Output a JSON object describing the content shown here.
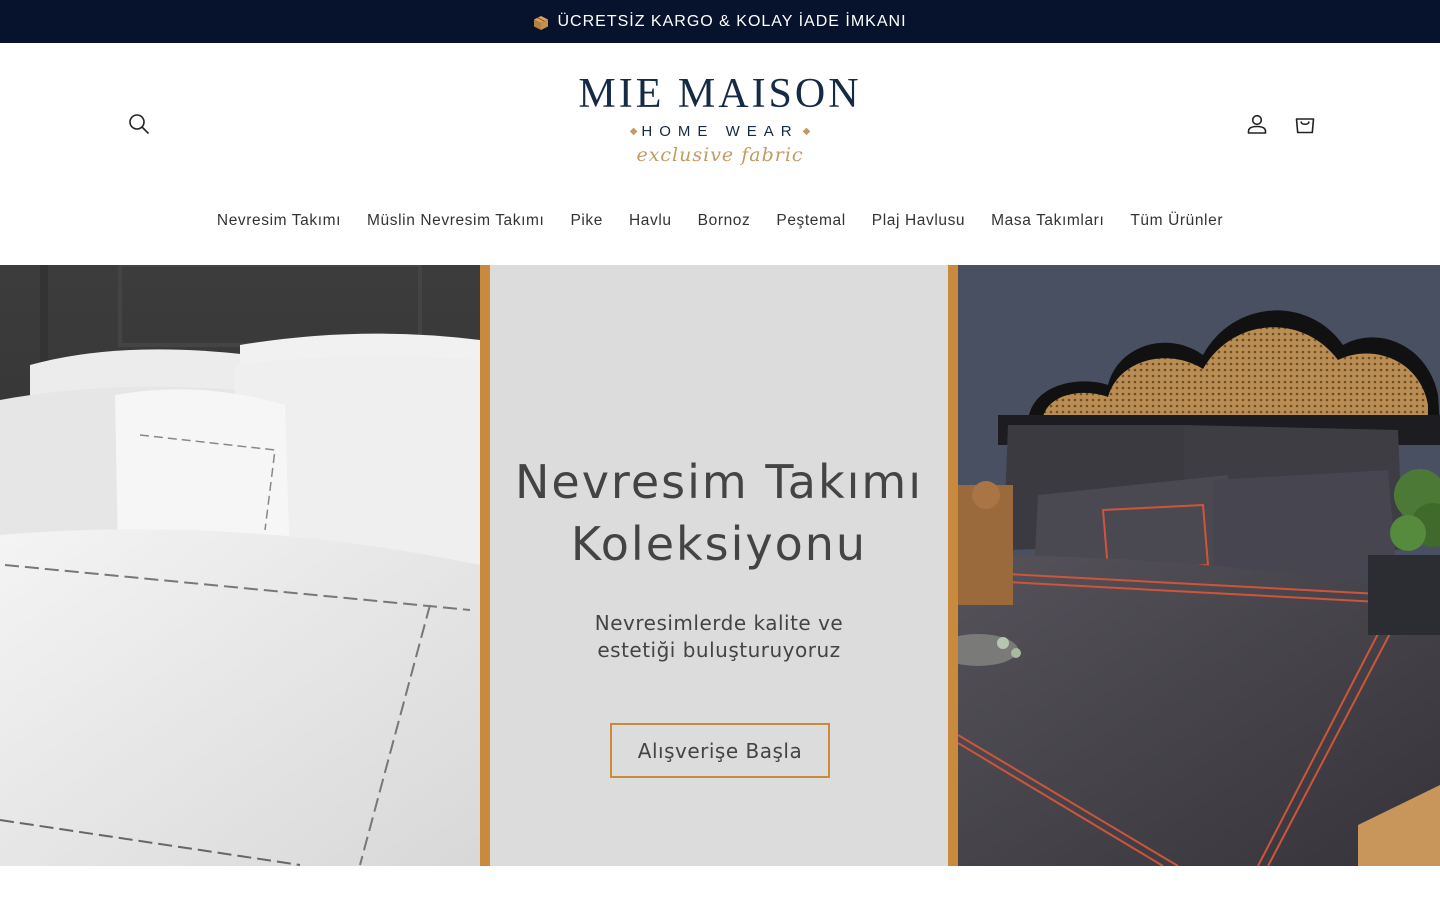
{
  "announcement": {
    "icon": "package-icon",
    "text": "ÜCRETSİZ KARGO & KOLAY İADE İMKANI"
  },
  "header": {
    "logo": {
      "brand": "MIE MAISON",
      "sub": "HOME WEAR",
      "tagline": "exclusive fabric"
    },
    "icons": {
      "search": "search-icon",
      "account": "user-icon",
      "cart": "cart-icon"
    }
  },
  "nav": {
    "items": [
      "Nevresim Takımı",
      "Müslin Nevresim Takımı",
      "Pike",
      "Havlu",
      "Bornoz",
      "Peştemal",
      "Plaj Havlusu",
      "Masa Takımları",
      "Tüm Ürünler"
    ]
  },
  "hero": {
    "title_line1": "Nevresim Takımı",
    "title_line2": "Koleksiyonu",
    "subtitle_line1": "Nevresimlerde kalite ve",
    "subtitle_line2": "estetiği buluşturuyoruz",
    "cta": "Alışverişe Başla",
    "colors": {
      "accent": "#c98a3d",
      "center_bg": "#dcdcdc",
      "announcement_bg": "#07132d",
      "brand": "#152a45"
    }
  }
}
